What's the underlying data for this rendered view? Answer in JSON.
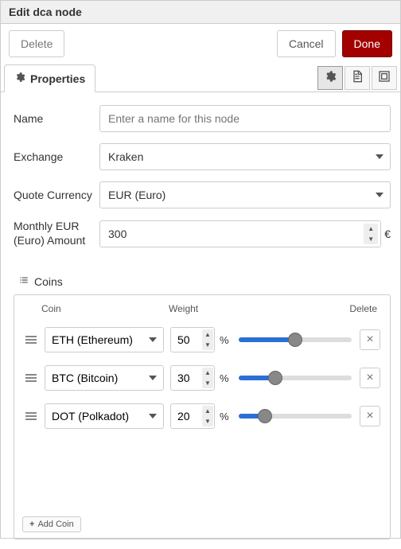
{
  "title": "Edit dca node",
  "header": {
    "delete_label": "Delete",
    "cancel_label": "Cancel",
    "done_label": "Done"
  },
  "tab": {
    "properties_label": "Properties"
  },
  "form": {
    "name_label": "Name",
    "name_placeholder": "Enter a name for this node",
    "name_value": "",
    "exchange_label": "Exchange",
    "exchange_value": "Kraken",
    "quote_label": "Quote Currency",
    "quote_value": "EUR (Euro)",
    "amount_label": "Monthly EUR (Euro) Amount",
    "amount_value": "300",
    "currency_suffix": "€"
  },
  "coins": {
    "section_label": "Coins",
    "col_coin": "Coin",
    "col_weight": "Weight",
    "col_delete": "Delete",
    "add_label": "Add Coin",
    "rows": [
      {
        "coin": "ETH (Ethereum)",
        "weight": "50"
      },
      {
        "coin": "BTC (Bitcoin)",
        "weight": "30"
      },
      {
        "coin": "DOT (Polkadot)",
        "weight": "20"
      }
    ]
  },
  "colors": {
    "accent": "#2a6fd6"
  }
}
